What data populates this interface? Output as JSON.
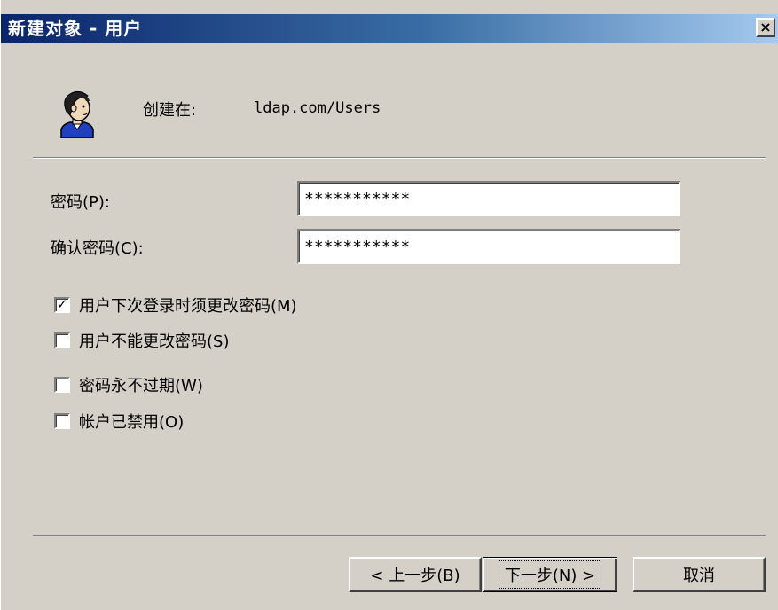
{
  "window": {
    "title": "新建对象 - 用户",
    "close_glyph": "×"
  },
  "header": {
    "created_in_label": "创建在:",
    "created_in_path": "ldap.com/Users",
    "icon": "user-icon"
  },
  "fields": {
    "password_label": "密码(P):",
    "password_value": "***********",
    "confirm_label": "确认密码(C):",
    "confirm_value": "***********"
  },
  "options": [
    {
      "label": "用户下次登录时须更改密码(M)",
      "checked": true
    },
    {
      "label": "用户不能更改密码(S)",
      "checked": false
    },
    {
      "label": "密码永不过期(W)",
      "checked": false
    },
    {
      "label": "帐户已禁用(O)",
      "checked": false
    }
  ],
  "buttons": {
    "back": "< 上一步(B)",
    "next": "下一步(N) >",
    "cancel": "取消"
  },
  "colors": {
    "title_start": "#0a246a",
    "title_end": "#a6caf0",
    "face": "#d4d0c8"
  }
}
